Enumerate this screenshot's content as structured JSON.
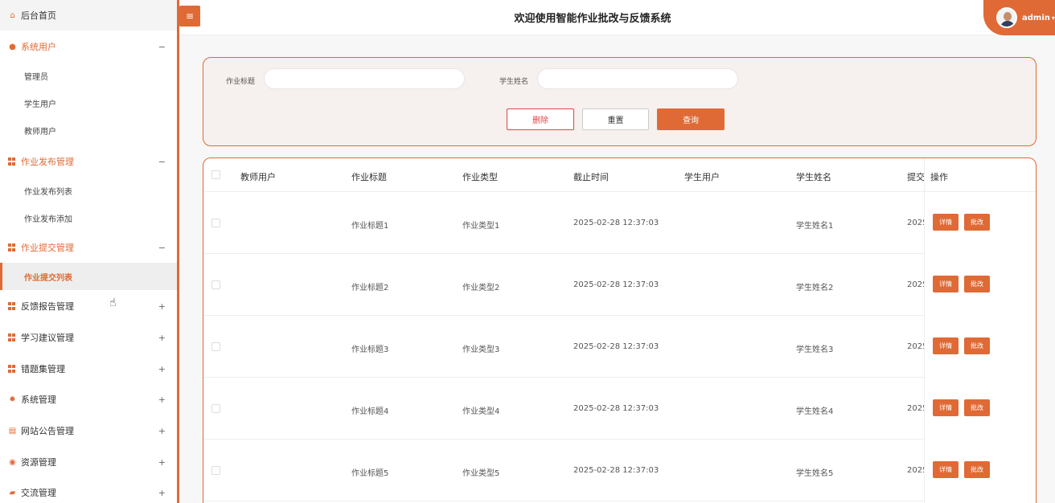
{
  "header": {
    "title": "欢迎使用智能作业批改与反馈系统",
    "user": "admin",
    "menu_toggle": "≡"
  },
  "sidebar": {
    "home": "后台首页",
    "sections": [
      {
        "label": "系统用户",
        "toggle": "−",
        "icon": "user-circle-icon",
        "open": true,
        "items": [
          "管理员",
          "学生用户",
          "教师用户"
        ]
      },
      {
        "label": "作业发布管理",
        "toggle": "−",
        "icon": "grid-icon",
        "open": true,
        "items": [
          "作业发布列表",
          "作业发布添加"
        ]
      },
      {
        "label": "作业提交管理",
        "toggle": "−",
        "icon": "grid-icon",
        "open": true,
        "items": [
          "作业提交列表"
        ]
      },
      {
        "label": "反馈报告管理",
        "toggle": "+",
        "icon": "grid-icon"
      },
      {
        "label": "学习建议管理",
        "toggle": "+",
        "icon": "grid-icon"
      },
      {
        "label": "错题集管理",
        "toggle": "+",
        "icon": "grid-icon"
      },
      {
        "label": "系统管理",
        "toggle": "+",
        "icon": "gear-icon"
      },
      {
        "label": "网站公告管理",
        "toggle": "+",
        "icon": "document-icon"
      },
      {
        "label": "资源管理",
        "toggle": "+",
        "icon": "database-icon"
      },
      {
        "label": "交流管理",
        "toggle": "+",
        "icon": "chat-icon"
      }
    ]
  },
  "search": {
    "title_label": "作业标题",
    "title_value": "",
    "student_label": "学生姓名",
    "student_value": "",
    "delete": "删除",
    "reset": "重置",
    "query": "查询"
  },
  "table": {
    "columns": [
      "教师用户",
      "作业标题",
      "作业类型",
      "截止时间",
      "学生用户",
      "学生姓名",
      "提交",
      "操作"
    ],
    "rows": [
      {
        "teacher": "",
        "title": "作业标题1",
        "type": "作业类型1",
        "deadline": "2025-02-28 12:37:03",
        "student_user": "",
        "student_name": "学生姓名1",
        "submit": "2025"
      },
      {
        "teacher": "",
        "title": "作业标题2",
        "type": "作业类型2",
        "deadline": "2025-02-28 12:37:03",
        "student_user": "",
        "student_name": "学生姓名2",
        "submit": "2025"
      },
      {
        "teacher": "",
        "title": "作业标题3",
        "type": "作业类型3",
        "deadline": "2025-02-28 12:37:03",
        "student_user": "",
        "student_name": "学生姓名3",
        "submit": "2025"
      },
      {
        "teacher": "",
        "title": "作业标题4",
        "type": "作业类型4",
        "deadline": "2025-02-28 12:37:03",
        "student_user": "",
        "student_name": "学生姓名4",
        "submit": "2025"
      },
      {
        "teacher": "",
        "title": "作业标题5",
        "type": "作业类型5",
        "deadline": "2025-02-28 12:37:03",
        "student_user": "",
        "student_name": "学生姓名5",
        "submit": "2025"
      }
    ],
    "detail_label": "详情",
    "grade_label": "批改"
  },
  "colors": {
    "accent": "#e06a35",
    "danger": "#e04545"
  }
}
